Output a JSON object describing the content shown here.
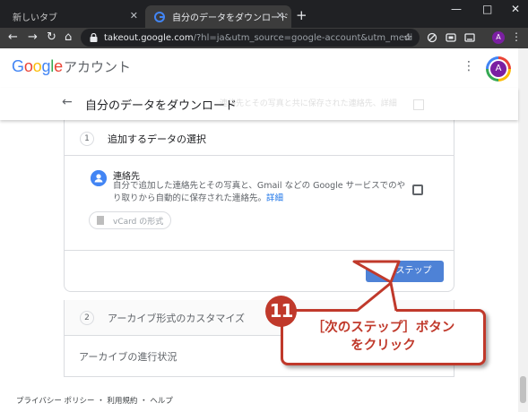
{
  "browser": {
    "tabs": [
      {
        "label": "新しいタブ",
        "active": false
      },
      {
        "label": "自分のデータをダウンロード",
        "active": true
      }
    ],
    "newtab_label": "+",
    "window_controls": {
      "minimize": "—",
      "maximize": "□",
      "close": "✕"
    },
    "url_host": "takeout.google.com",
    "url_rest": "/?hl=ja&utm_source=google-account&utm_medium=web",
    "profile_letter": "A"
  },
  "header": {
    "logo_letters": [
      "G",
      "o",
      "o",
      "g",
      "l",
      "e"
    ],
    "logo_colors": [
      "#4285f4",
      "#ea4335",
      "#fbbc05",
      "#4285f4",
      "#34a853",
      "#ea4335"
    ],
    "account_label": "アカウント",
    "avatar_letter": "A"
  },
  "title_bar": {
    "title": "自分のデータをダウンロード",
    "ghost_text": "連絡先とその写真と共に保存された連絡先、詳細"
  },
  "steps": [
    {
      "number": "1",
      "title": "追加するデータの選択"
    },
    {
      "number": "2",
      "title": "アーカイブ形式のカスタマイズ"
    },
    {
      "number": "",
      "title": "アーカイブの進行状況"
    }
  ],
  "contact": {
    "name": "連絡先",
    "description": "自分で追加した連絡先とその写真と、Gmail などの Google サービスでのやり取りから自動的に保存された連絡先。",
    "details_link": "詳細",
    "format_chip": "vCard の形式"
  },
  "next_button": "次のステップ",
  "footer": "プライバシー ポリシー ・ 利用規約 ・ ヘルプ",
  "annotation": {
    "number": "11",
    "text": "［次のステップ］ボタン\nをクリック",
    "color": "#c0392b"
  }
}
